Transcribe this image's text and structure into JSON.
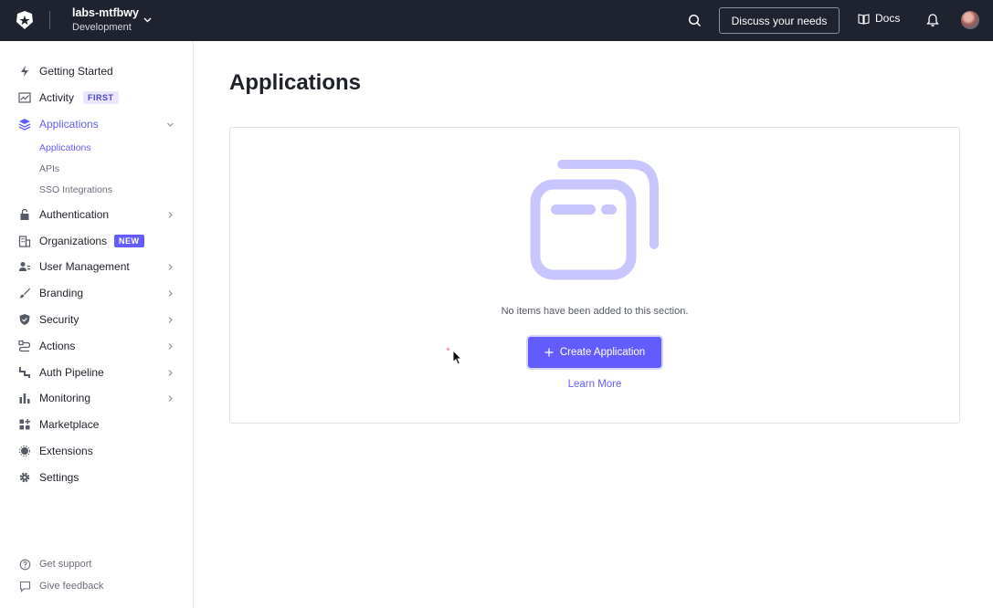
{
  "topbar": {
    "tenant_name": "labs-mtfbwy",
    "tenant_env": "Development",
    "discuss_label": "Discuss your needs",
    "docs_label": "Docs"
  },
  "sidebar": {
    "items": [
      {
        "label": "Getting Started",
        "icon": "bolt-icon"
      },
      {
        "label": "Activity",
        "icon": "activity-chart-icon",
        "badge": "FIRST"
      },
      {
        "label": "Applications",
        "icon": "layers-icon",
        "expanded": true
      },
      {
        "label": "Authentication",
        "icon": "lock-icon"
      },
      {
        "label": "Organizations",
        "icon": "building-icon",
        "badge": "NEW"
      },
      {
        "label": "User Management",
        "icon": "users-icon"
      },
      {
        "label": "Branding",
        "icon": "brush-icon"
      },
      {
        "label": "Security",
        "icon": "shield-icon"
      },
      {
        "label": "Actions",
        "icon": "flow-icon"
      },
      {
        "label": "Auth Pipeline",
        "icon": "pipeline-icon"
      },
      {
        "label": "Monitoring",
        "icon": "bar-chart-icon"
      },
      {
        "label": "Marketplace",
        "icon": "grid-plus-icon"
      },
      {
        "label": "Extensions",
        "icon": "puzzle-icon"
      },
      {
        "label": "Settings",
        "icon": "gear-icon"
      }
    ],
    "sub_items": [
      "Applications",
      "APIs",
      "SSO Integrations"
    ],
    "footer": [
      {
        "label": "Get support",
        "icon": "help-circle-icon"
      },
      {
        "label": "Give feedback",
        "icon": "feedback-icon"
      }
    ]
  },
  "main": {
    "title": "Applications",
    "empty_text": "No items have been added to this section.",
    "create_label": "Create Application",
    "learn_more": "Learn More"
  },
  "colors": {
    "accent": "#635dff",
    "topbar_bg": "#1f2330",
    "illustration": "#c9c6ff"
  }
}
